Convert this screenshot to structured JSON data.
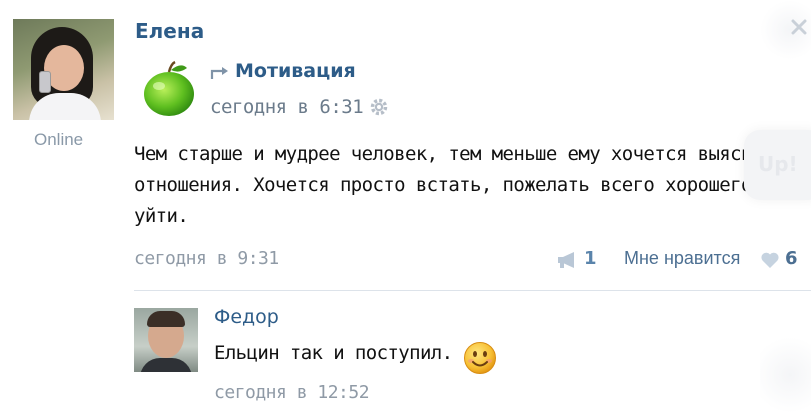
{
  "post": {
    "author": "Елена",
    "status": "Online",
    "group": "Мотивация",
    "time": "сегодня в 6:31",
    "text": "Чем старше и мудрее человек, тем меньше ему хочется выяснять отношения. Хочется просто встать, пожелать всего хорошего и уйти.",
    "footer_time": "сегодня в 9:31",
    "share_count": "1",
    "like_label": "Мне нравится",
    "like_count": "6"
  },
  "comment": {
    "author": "Федор",
    "text": "Ельцин так и поступил.",
    "time": "сегодня в 12:52"
  },
  "scroll": {
    "up_label": "Up!"
  },
  "icons": {
    "close": "close-icon",
    "gear": "gear-icon",
    "share": "megaphone-icon",
    "like": "heart-icon",
    "emoji": "smile-icon",
    "group_link": "repost-arrow-icon"
  },
  "colors": {
    "link": "#2d5c88",
    "muted": "#8f9aa6",
    "divider": "#dde3ea"
  }
}
